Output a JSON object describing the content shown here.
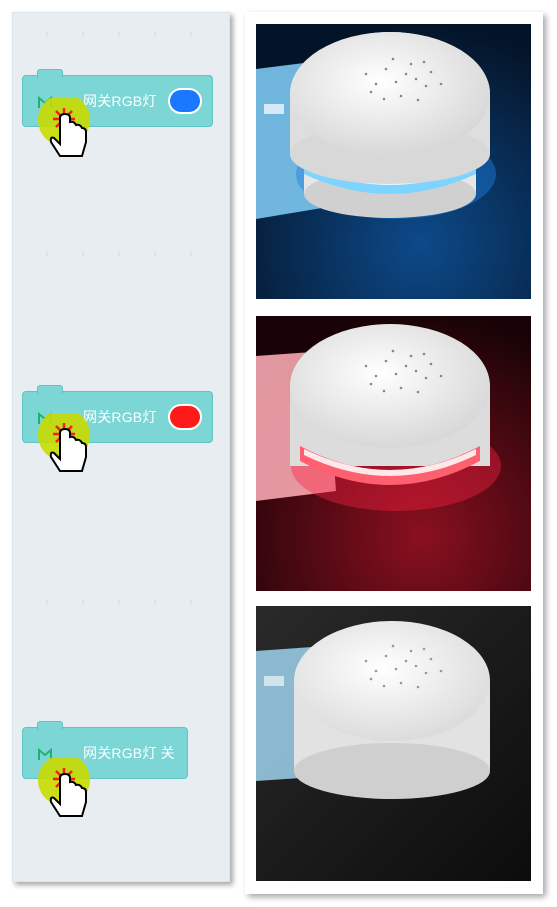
{
  "blocks": [
    {
      "label": "网关RGB灯",
      "toggle_color": "#1a78ff",
      "has_toggle": true,
      "icon": "mi-home-icon"
    },
    {
      "label": "网关RGB灯",
      "toggle_color": "#ff1a1a",
      "has_toggle": true,
      "icon": "mi-home-icon"
    },
    {
      "label": "网关RGB灯 关",
      "has_toggle": false,
      "icon": "mi-home-icon"
    }
  ],
  "photos": [
    {
      "description_state": "blue",
      "ring_color": "#3ab0ff"
    },
    {
      "description_state": "red",
      "ring_color": "#ff3040"
    },
    {
      "description_state": "off",
      "ring_color": "#dddddd"
    }
  ],
  "colors": {
    "block_fill": "#7dd6d6",
    "workspace_bg": "#e8edf2",
    "click_highlight": "#c8dc00"
  }
}
